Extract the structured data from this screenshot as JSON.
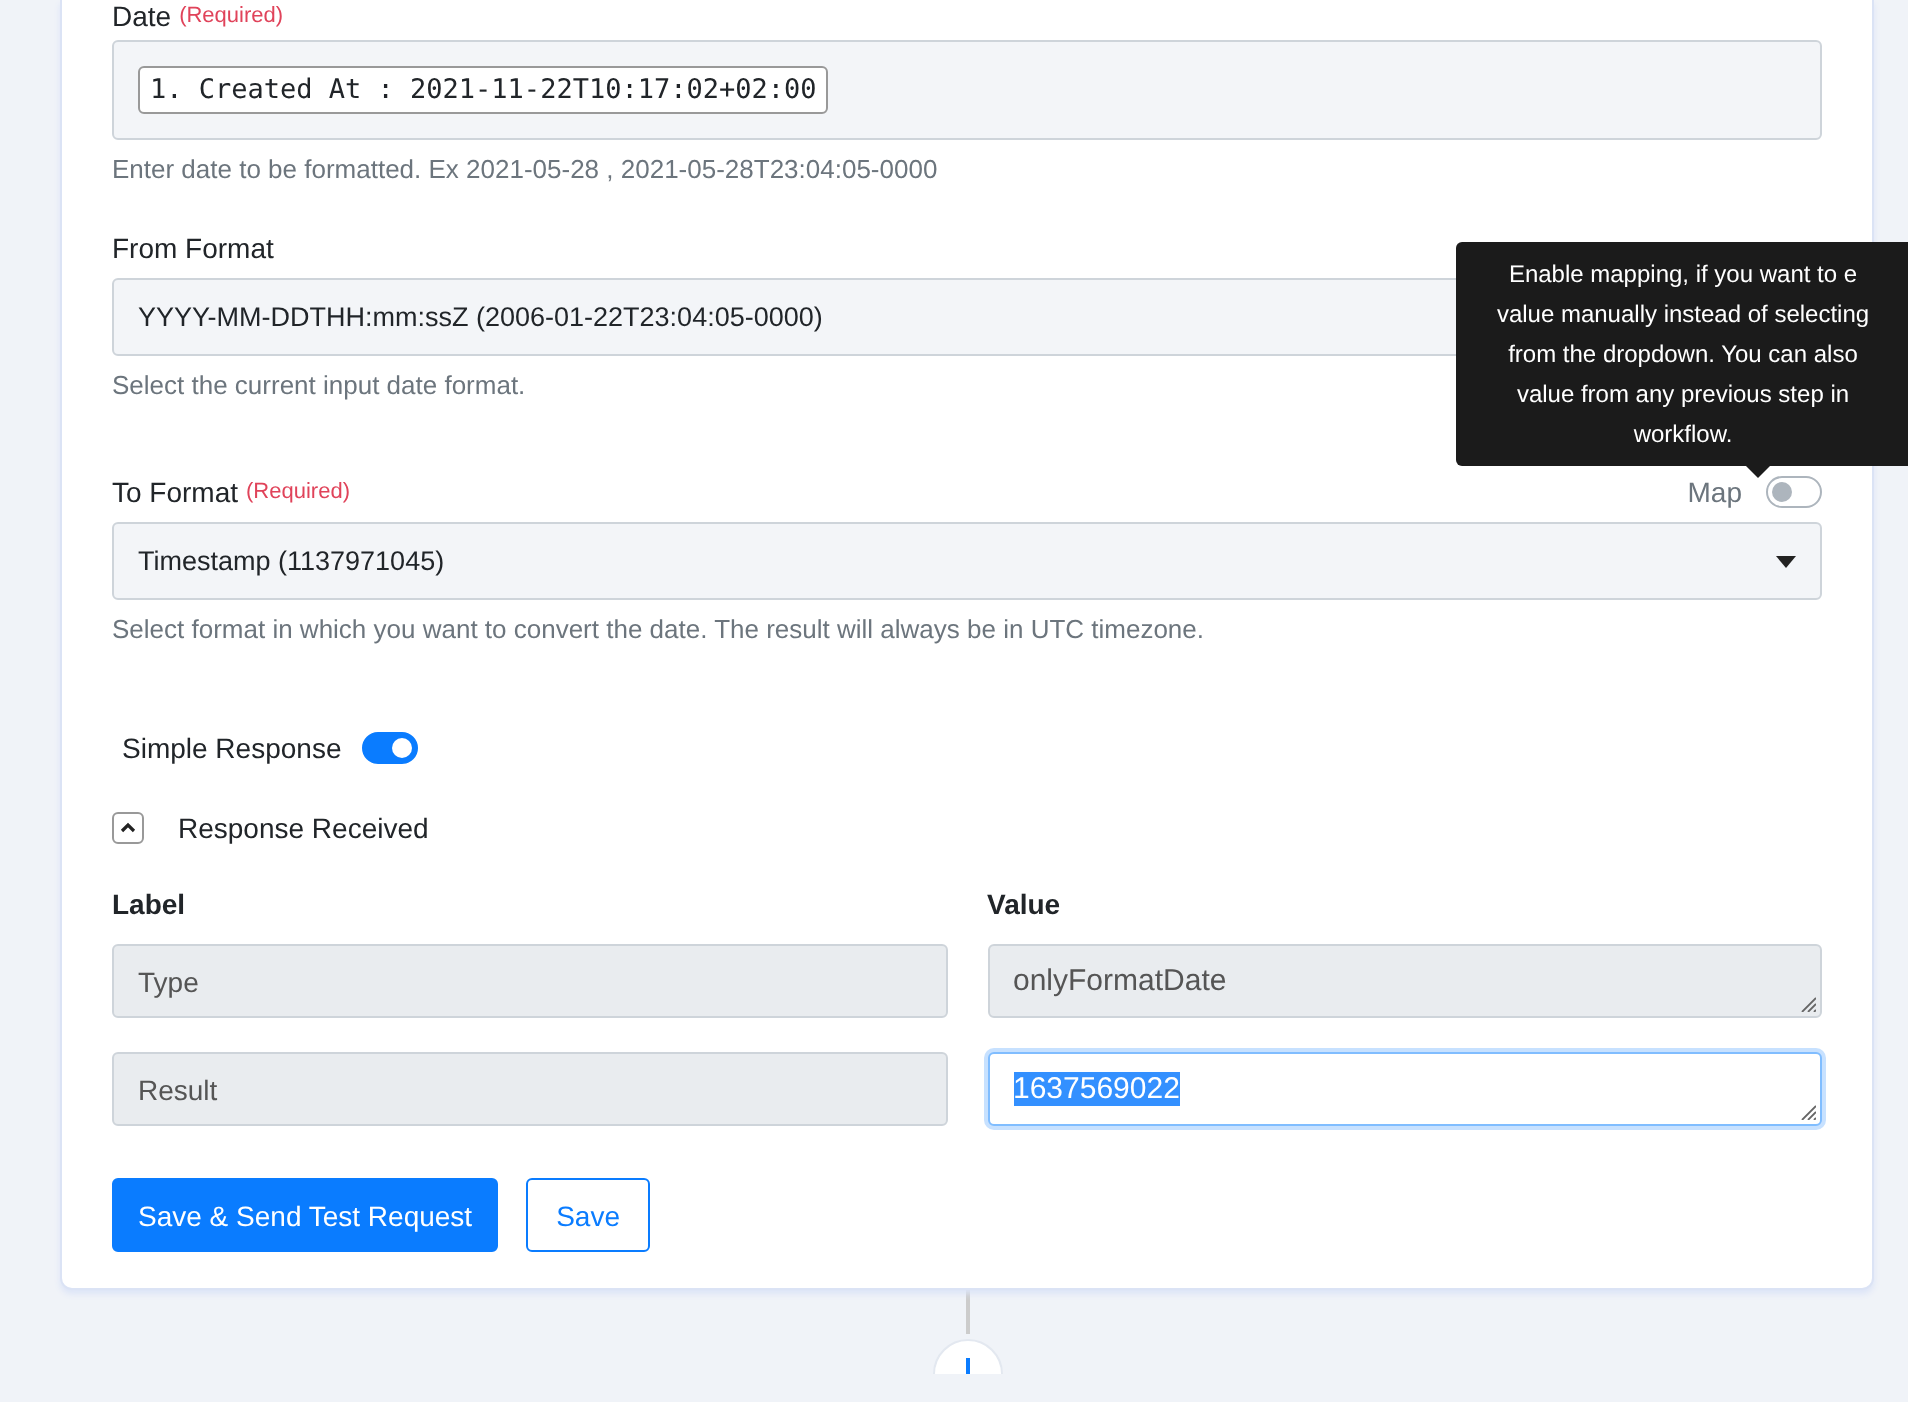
{
  "date_field": {
    "label": "Date",
    "required": "(Required)",
    "token": "1. Created At : 2021-11-22T10:17:02+02:00",
    "hint": "Enter date to be formatted. Ex 2021-05-28 , 2021-05-28T23:04:05-0000"
  },
  "from_format": {
    "label": "From Format",
    "value": "YYYY-MM-DDTHH:mm:ssZ (2006-01-22T23:04:05-0000)",
    "hint": "Select the current input date format."
  },
  "tooltip": {
    "lines": [
      "Enable mapping, if you want to e",
      "value manually instead of selecting",
      "from the dropdown. You can also",
      "value from any previous step in",
      "workflow."
    ]
  },
  "to_format": {
    "label": "To Format",
    "required": "(Required)",
    "map_label": "Map",
    "map_on": false,
    "value": "Timestamp (1137971045)",
    "hint": "Select format in which you want to convert the date. The result will always be in UTC timezone."
  },
  "simple_response": {
    "label": "Simple Response",
    "on": true
  },
  "response": {
    "title": "Response Received",
    "expanded": true,
    "columns": [
      "Label",
      "Value"
    ],
    "rows": [
      {
        "label": "Type",
        "value": "onlyFormatDate",
        "selected": false
      },
      {
        "label": "Result",
        "value": "1637569022",
        "selected": true
      }
    ]
  },
  "buttons": [
    {
      "label": "Save & Send Test Request",
      "kind": "primary"
    },
    {
      "label": "Save",
      "kind": "outline"
    }
  ]
}
